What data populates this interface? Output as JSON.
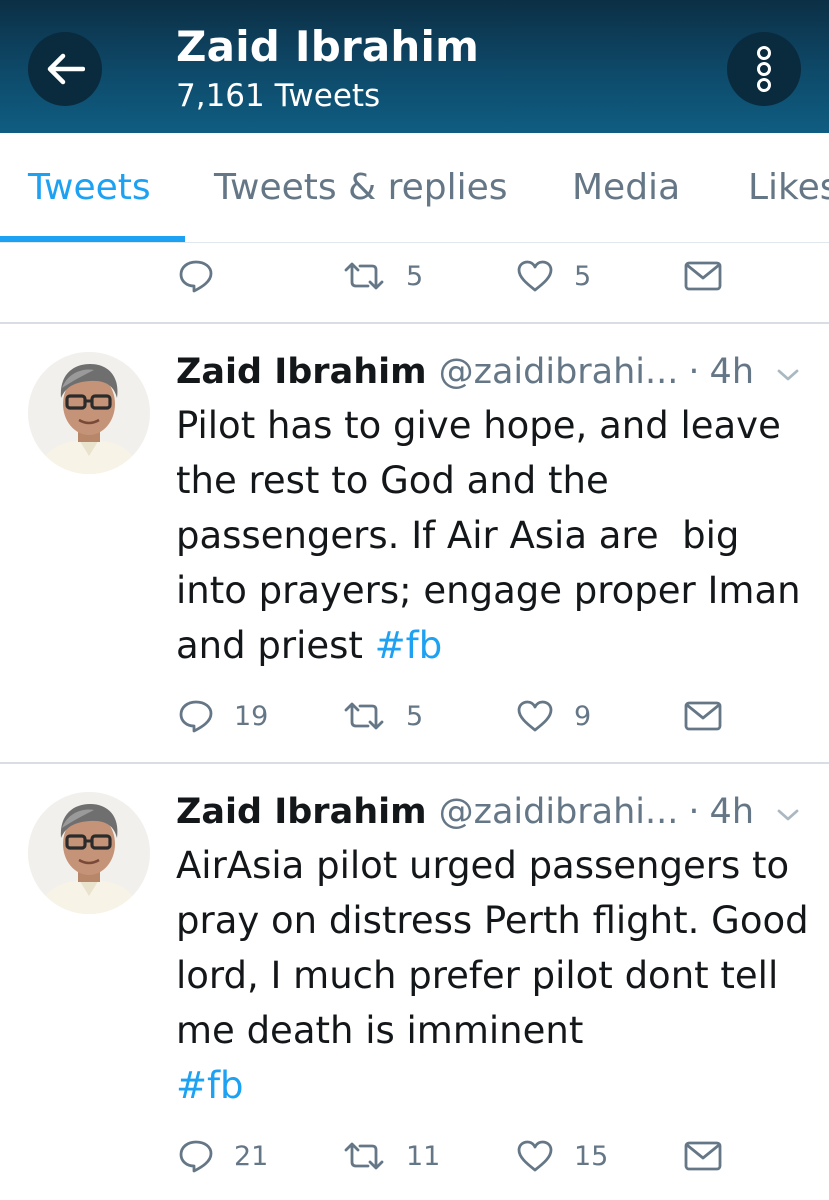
{
  "header": {
    "title": "Zaid Ibrahim",
    "subtitle": "7,161 Tweets",
    "back_icon": "arrow-left-icon",
    "more_icon": "vertical-dots-icon",
    "gradient_top": "#0c2f45",
    "gradient_bottom": "#0f5d82"
  },
  "tabs": [
    {
      "label": "Tweets",
      "active": true
    },
    {
      "label": "Tweets & replies",
      "active": false
    },
    {
      "label": "Media",
      "active": false
    },
    {
      "label": "Likes",
      "active": false
    }
  ],
  "accent_color": "#1da1f2",
  "previous_tweet_actions": {
    "replies": "",
    "retweets": "5",
    "likes": "5"
  },
  "tweets": [
    {
      "name": "Zaid Ibrahim",
      "handle": "@zaidibrahi...",
      "separator": "·",
      "time": "4h",
      "text": "Pilot has to give hope, and leave the rest to God and the passengers. If Air Asia are  big into prayers; engage proper Iman and priest ",
      "hashtag": "#fb",
      "replies": "19",
      "retweets": "5",
      "likes": "9"
    },
    {
      "name": "Zaid Ibrahim",
      "handle": "@zaidibrahi...",
      "separator": "·",
      "time": "4h",
      "text": "AirAsia pilot urged passengers to pray on distress Perth flight. Good lord, I much prefer pilot dont tell me death is imminent\n",
      "hashtag": "#fb",
      "replies": "21",
      "retweets": "11",
      "likes": "15"
    }
  ]
}
